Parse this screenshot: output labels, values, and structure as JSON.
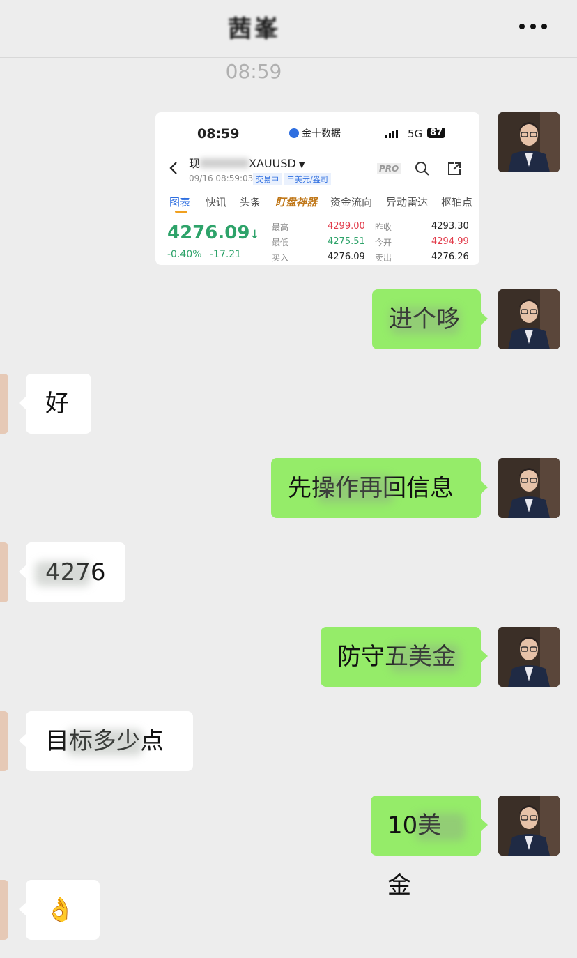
{
  "chat": {
    "title": "茜峯",
    "time": "08:59"
  },
  "shared_screenshot": {
    "status_time": "08:59",
    "app_name": "金十数据",
    "network": "5G",
    "battery": "87",
    "instrument_prefix": "现",
    "instrument_symbol": "XAUUSD",
    "datetime": "09/16 08:59:03",
    "status_badge": "交易中",
    "currency_badge": "〒美元/盎司",
    "pro_label": "PRO",
    "tabs": [
      "图表",
      "快讯",
      "头条",
      "盯盘神器",
      "资金流向",
      "异动雷达",
      "枢轴点"
    ],
    "price": "4276.09",
    "change_pct": "-0.40%",
    "change_abs": "-17.21",
    "stats": [
      {
        "label": "最高",
        "value": "4299.00",
        "label2": "昨收",
        "value2": "4293.30"
      },
      {
        "label": "最低",
        "value": "4275.51",
        "label2": "今开",
        "value2": "4294.99"
      },
      {
        "label": "买入",
        "value": "4276.09",
        "label2": "卖出",
        "value2": "4276.26"
      }
    ]
  },
  "messages": [
    {
      "side": "out",
      "text": "进个哆"
    },
    {
      "side": "in",
      "text": "好"
    },
    {
      "side": "out",
      "text": "先操作再回信息"
    },
    {
      "side": "in",
      "text": "4276"
    },
    {
      "side": "out",
      "text": "防守五美金"
    },
    {
      "side": "in",
      "text": "目标多少点"
    },
    {
      "side": "out",
      "text": "10美金"
    },
    {
      "side": "in",
      "text": "👌"
    }
  ],
  "colors": {
    "background": "#ededed",
    "bubble_out": "#95ec69",
    "bubble_in": "#ffffff",
    "price_up": "#e23b4a",
    "price_down": "#2ea36a",
    "accent_blue": "#2f6fe0"
  }
}
